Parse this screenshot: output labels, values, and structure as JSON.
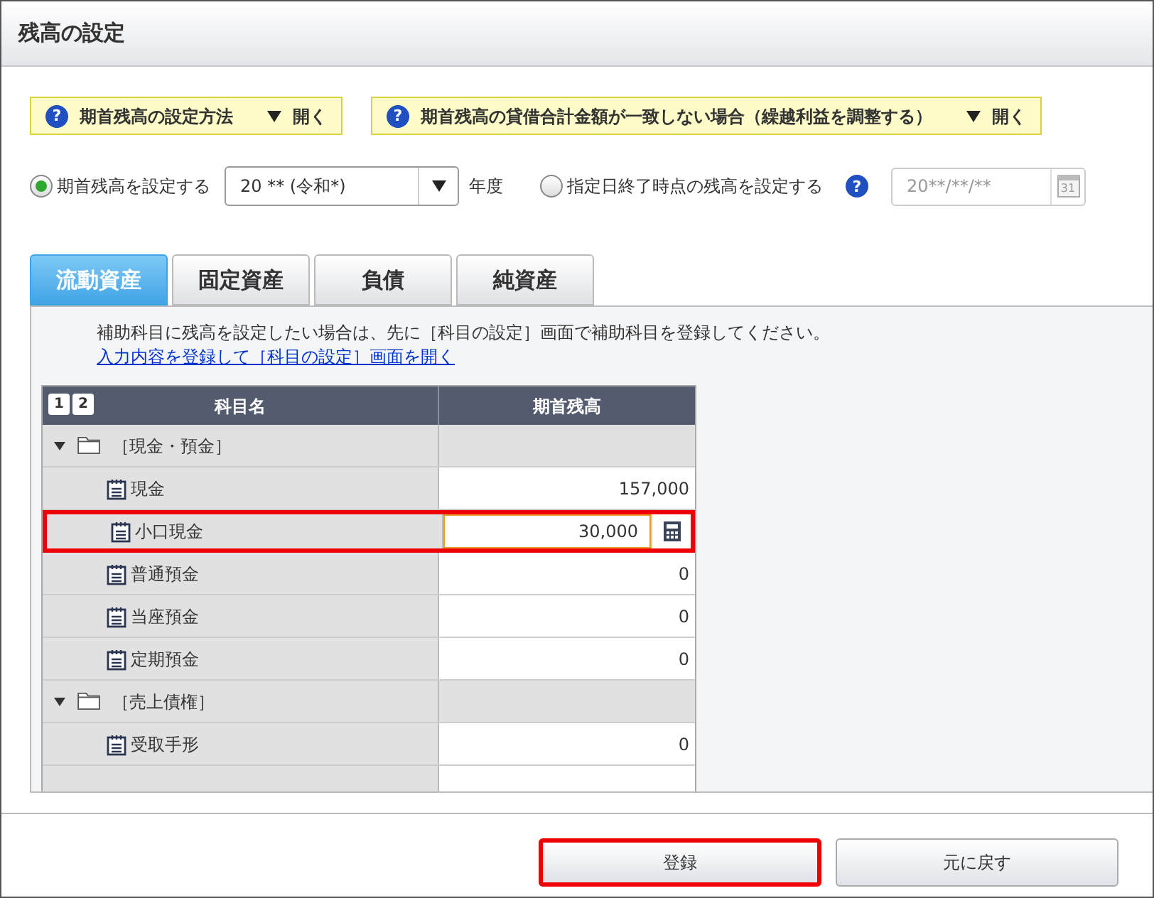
{
  "window": {
    "title": "残高の設定"
  },
  "help_links": [
    {
      "icon": "?",
      "label": "期首残高の設定方法",
      "toggle": "開く"
    },
    {
      "icon": "?",
      "label": "期首残高の貸借合計金額が一致しない場合（繰越利益を調整する）",
      "toggle": "開く"
    }
  ],
  "modes": [
    {
      "kind": "year",
      "label": "期首残高を設定する",
      "selected": true,
      "value": "20 ** (令和*)",
      "unit": "年度"
    },
    {
      "kind": "date",
      "label": "指定日終了時点の残高を設定する",
      "selected": false,
      "help_icon": "?",
      "placeholder": "20**/**/**",
      "calendar_day": "31"
    }
  ],
  "tabs": [
    {
      "label": "流動資産",
      "selected": true
    },
    {
      "label": "固定資産",
      "selected": false
    },
    {
      "label": "負債",
      "selected": false
    },
    {
      "label": "純資産",
      "selected": false
    }
  ],
  "note": "補助科目に残高を設定したい場合は、先に［科目の設定］画面で補助科目を登録してください。",
  "note_link": "入力内容を登録して［科目の設定］画面を開く",
  "table": {
    "level_buttons": [
      "1",
      "2"
    ],
    "columns": [
      "科目名",
      "期首残高"
    ],
    "rows": [
      {
        "name": "［現金・預金］",
        "expanded": true,
        "children": [
          {
            "name": "現金",
            "value": "157,000",
            "highlighted": false
          },
          {
            "name": "小口現金",
            "value": "30,000",
            "highlighted": true
          },
          {
            "name": "普通預金",
            "value": "0",
            "highlighted": false
          },
          {
            "name": "当座預金",
            "value": "0",
            "highlighted": false
          },
          {
            "name": "定期預金",
            "value": "0",
            "highlighted": false
          }
        ]
      },
      {
        "name": "［売上債権］",
        "expanded": true,
        "children": [
          {
            "name": "受取手形",
            "value": "0",
            "highlighted": false
          }
        ]
      }
    ]
  },
  "buttons": [
    {
      "label": "登録",
      "highlighted": true
    },
    {
      "label": "元に戻す",
      "highlighted": false
    }
  ]
}
